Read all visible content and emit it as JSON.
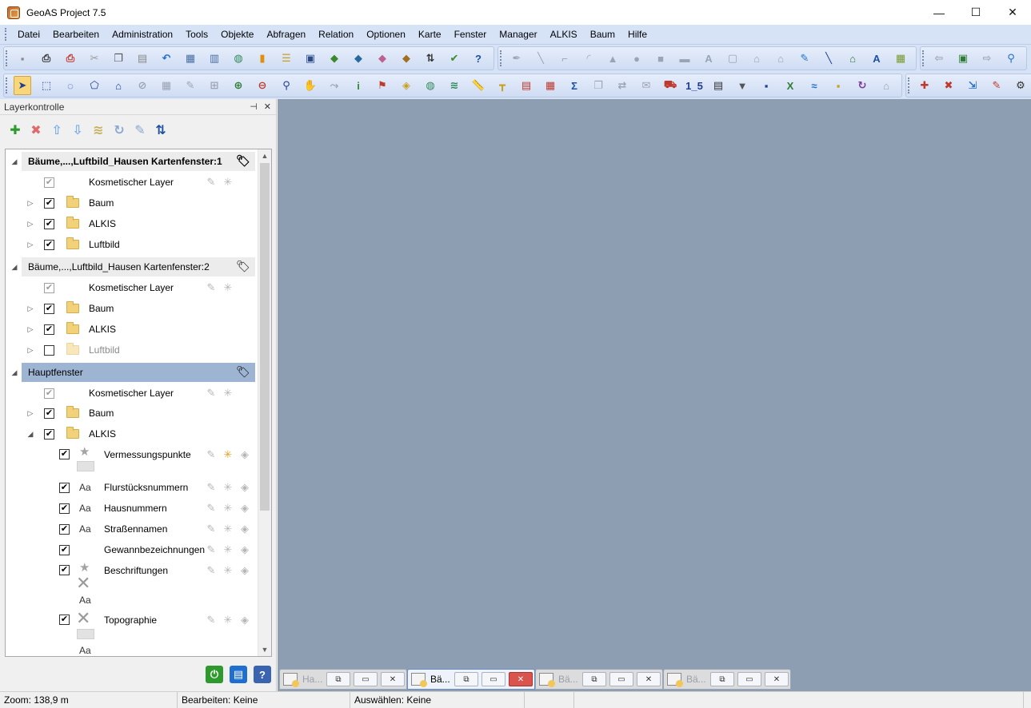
{
  "window": {
    "title": "GeoAS Project 7.5",
    "minimize": "—",
    "maximize": "☐",
    "close": "✕"
  },
  "menu": [
    "Datei",
    "Bearbeiten",
    "Administration",
    "Tools",
    "Objekte",
    "Abfragen",
    "Relation",
    "Optionen",
    "Karte",
    "Fenster",
    "Manager",
    "ALKIS",
    "Baum",
    "Hilfe"
  ],
  "toolbar1": {
    "group1": [
      {
        "name": "save-icon",
        "glyph": "▪",
        "color": "#8a8a8a"
      },
      {
        "name": "print-icon",
        "glyph": "⎙",
        "color": "#333333"
      },
      {
        "name": "pdf-print-icon",
        "glyph": "⎙",
        "color": "#c0392b"
      },
      {
        "name": "cut-icon",
        "glyph": "✂",
        "color": "#9a9a9a"
      },
      {
        "name": "copy-icon",
        "glyph": "❐",
        "color": "#555555"
      },
      {
        "name": "paste-icon",
        "glyph": "▤",
        "color": "#8a8a8a"
      },
      {
        "name": "undo-icon",
        "glyph": "↶",
        "color": "#1f6fd0"
      },
      {
        "name": "table-icon",
        "glyph": "▦",
        "color": "#4a6fa5"
      },
      {
        "name": "table-view-icon",
        "glyph": "▥",
        "color": "#4a6fa5"
      },
      {
        "name": "map-globe-icon",
        "glyph": "◍",
        "color": "#2e8b57"
      },
      {
        "name": "chart-icon",
        "glyph": "▮",
        "color": "#e08e0b"
      },
      {
        "name": "list-icon",
        "glyph": "☰",
        "color": "#c8a020"
      },
      {
        "name": "layer-window-icon",
        "glyph": "▣",
        "color": "#2a4a8a"
      },
      {
        "name": "map-green-icon",
        "glyph": "◆",
        "color": "#3a8a2a"
      },
      {
        "name": "map-tool-icon",
        "glyph": "◆",
        "color": "#2a6a9a"
      },
      {
        "name": "map-pink-icon",
        "glyph": "◆",
        "color": "#c06090"
      },
      {
        "name": "map-edit-icon",
        "glyph": "◆",
        "color": "#a07020"
      },
      {
        "name": "sort-az-icon",
        "glyph": "⇅",
        "color": "#333333"
      },
      {
        "name": "map-check-icon",
        "glyph": "✔",
        "color": "#3a8a2a"
      },
      {
        "name": "help-icon",
        "glyph": "?",
        "color": "#1f4fa0"
      }
    ],
    "group2": [
      {
        "name": "point-pin-icon",
        "glyph": "✒",
        "color": "#9aa4b2"
      },
      {
        "name": "line-icon",
        "glyph": "╲",
        "color": "#9aa4b2"
      },
      {
        "name": "polyline-icon",
        "glyph": "⌐",
        "color": "#9aa4b2"
      },
      {
        "name": "arc-icon",
        "glyph": "◜",
        "color": "#9aa4b2"
      },
      {
        "name": "polygon-icon",
        "glyph": "▲",
        "color": "#9aa4b2"
      },
      {
        "name": "ellipse-icon",
        "glyph": "●",
        "color": "#9aa4b2"
      },
      {
        "name": "rectangle-icon",
        "glyph": "■",
        "color": "#9aa4b2"
      },
      {
        "name": "rounded-rect-icon",
        "glyph": "▬",
        "color": "#9aa4b2"
      },
      {
        "name": "text-a-icon",
        "glyph": "A",
        "color": "#9aa4b2"
      },
      {
        "name": "frame-icon",
        "glyph": "▢",
        "color": "#9aa4b2"
      },
      {
        "name": "house-outline-icon",
        "glyph": "⌂",
        "color": "#9aa4b2"
      },
      {
        "name": "house-add-icon",
        "glyph": "⌂",
        "color": "#9aa4b2"
      },
      {
        "name": "pin-blue-icon",
        "glyph": "✎",
        "color": "#1f6fd0"
      },
      {
        "name": "line-blue-icon",
        "glyph": "╲",
        "color": "#1f3f90"
      },
      {
        "name": "house-green-icon",
        "glyph": "⌂",
        "color": "#2e7d32"
      },
      {
        "name": "text-blue-icon",
        "glyph": "A",
        "color": "#1f4fa0"
      },
      {
        "name": "grid-edit-icon",
        "glyph": "▦",
        "color": "#7a9a2a"
      }
    ],
    "group3": [
      {
        "name": "back-icon",
        "glyph": "⇦",
        "color": "#9aa4b2"
      },
      {
        "name": "zoom-window-icon",
        "glyph": "▣",
        "color": "#2e7d32"
      },
      {
        "name": "forward-icon",
        "glyph": "⇨",
        "color": "#9aa4b2"
      },
      {
        "name": "search-map-icon",
        "glyph": "⚲",
        "color": "#1f6fd0"
      }
    ]
  },
  "toolbar2": {
    "group1": [
      {
        "name": "select-arrow-icon",
        "glyph": "➤",
        "color": "#1f3f90",
        "active": true
      },
      {
        "name": "select-rect-icon",
        "glyph": "⬚",
        "color": "#1f3f90"
      },
      {
        "name": "select-circle-icon",
        "glyph": "◌",
        "color": "#1f3f90"
      },
      {
        "name": "select-polygon-icon",
        "glyph": "⬠",
        "color": "#1f3f90"
      },
      {
        "name": "select-house-icon",
        "glyph": "⌂",
        "color": "#1f3f90"
      },
      {
        "name": "deselect-icon",
        "glyph": "⊘",
        "color": "#9aa4b2"
      },
      {
        "name": "select-grid-icon",
        "glyph": "▦",
        "color": "#9aa4b2"
      },
      {
        "name": "pencil-icon",
        "glyph": "✎",
        "color": "#9aa4b2"
      },
      {
        "name": "ruler-select-icon",
        "glyph": "⊞",
        "color": "#9aa4b2"
      },
      {
        "name": "zoom-in-icon",
        "glyph": "⊕",
        "color": "#2e7d32"
      },
      {
        "name": "zoom-out-icon",
        "glyph": "⊖",
        "color": "#c0392b"
      },
      {
        "name": "zoom-search-icon",
        "glyph": "⚲",
        "color": "#1f3f90"
      },
      {
        "name": "pan-hand-icon",
        "glyph": "✋",
        "color": "#555555"
      },
      {
        "name": "route-icon",
        "glyph": "⤳",
        "color": "#9aa4b2"
      },
      {
        "name": "info-icon",
        "glyph": "i",
        "color": "#2e8b2e"
      },
      {
        "name": "flag-icon",
        "glyph": "⚑",
        "color": "#c0392b"
      },
      {
        "name": "tag-icon",
        "glyph": "◈",
        "color": "#c8a020"
      },
      {
        "name": "map-click-icon",
        "glyph": "◍",
        "color": "#2e8b57"
      },
      {
        "name": "layers-icon",
        "glyph": "≋",
        "color": "#2e8b57"
      },
      {
        "name": "measure-icon",
        "glyph": "📏",
        "color": "#c8a020"
      },
      {
        "name": "t-ruler-icon",
        "glyph": "┳",
        "color": "#c8a020"
      },
      {
        "name": "legend-icon",
        "glyph": "▤",
        "color": "#c0392b"
      },
      {
        "name": "table-delete-icon",
        "glyph": "▦",
        "color": "#c0392b"
      },
      {
        "name": "sum-icon",
        "glyph": "Σ",
        "color": "#1f4fa0"
      },
      {
        "name": "copy-object-icon",
        "glyph": "❐",
        "color": "#9aa4b2"
      },
      {
        "name": "move-object-icon",
        "glyph": "⇄",
        "color": "#9aa4b2"
      },
      {
        "name": "envelope-icon",
        "glyph": "✉",
        "color": "#9aa4b2"
      },
      {
        "name": "car-icon",
        "glyph": "⛟",
        "color": "#c0392b"
      },
      {
        "name": "scale-bar-icon",
        "glyph": "1_5",
        "color": "#1f3f90"
      },
      {
        "name": "report-icon",
        "glyph": "▤",
        "color": "#333333"
      },
      {
        "name": "filter-icon",
        "glyph": "▼",
        "color": "#555555"
      },
      {
        "name": "save-disk-icon",
        "glyph": "▪",
        "color": "#1f3f90"
      },
      {
        "name": "excel-icon",
        "glyph": "X",
        "color": "#2e7d32"
      },
      {
        "name": "wave-icon",
        "glyph": "≈",
        "color": "#1f6fd0"
      },
      {
        "name": "disk-yellow-icon",
        "glyph": "▪",
        "color": "#c8a020"
      },
      {
        "name": "refresh-icon",
        "glyph": "↻",
        "color": "#7a3a9a"
      },
      {
        "name": "house-plus-icon",
        "glyph": "⌂",
        "color": "#9aa4b2"
      }
    ],
    "group2": [
      {
        "name": "layer-add-icon",
        "glyph": "✚",
        "color": "#c0392b"
      },
      {
        "name": "layer-delete-icon",
        "glyph": "✖",
        "color": "#c0392b"
      },
      {
        "name": "layer-import-icon",
        "glyph": "⇲",
        "color": "#1f6fd0"
      },
      {
        "name": "layer-edit-icon",
        "glyph": "✎",
        "color": "#c0392b"
      },
      {
        "name": "layer-settings-icon",
        "glyph": "⚙",
        "color": "#333333"
      }
    ]
  },
  "panel": {
    "title": "Layerkontrolle",
    "pin": "⊣",
    "close": "✕",
    "tools": [
      {
        "name": "add-layer-icon",
        "glyph": "✚",
        "color": "#2e9a2e"
      },
      {
        "name": "remove-layer-icon",
        "glyph": "✖",
        "color": "#e06a6a"
      },
      {
        "name": "move-up-icon",
        "glyph": "⇧",
        "color": "#7aaee8"
      },
      {
        "name": "move-down-icon",
        "glyph": "⇩",
        "color": "#7aaee8"
      },
      {
        "name": "layer-group-icon",
        "glyph": "≋",
        "color": "#c8b060"
      },
      {
        "name": "layer-refresh-icon",
        "glyph": "↻",
        "color": "#8aa8d0"
      },
      {
        "name": "layer-props-icon",
        "glyph": "✎",
        "color": "#8aa8d0"
      },
      {
        "name": "layer-sort-icon",
        "glyph": "⇅",
        "color": "#1f4fa0"
      }
    ],
    "windows": [
      {
        "title": "Bäume,...,Luftbild_Hausen Kartenfenster:1"
      },
      {
        "title": "Bäume,...,Luftbild_Hausen Kartenfenster:2"
      },
      {
        "title": "Hauptfenster"
      }
    ],
    "cosmetic_layer": "Kosmetischer Layer",
    "folders": {
      "baum": "Baum",
      "alkis": "ALKIS",
      "luftbild": "Luftbild"
    },
    "alkis_layers": [
      "Vermessungspunkte",
      "Flurstücksnummern",
      "Hausnummern",
      "Straßennamen",
      "Gewannbezeichnungen",
      "Beschriftungen",
      "Topographie"
    ],
    "aa": "Aa",
    "bottom": [
      {
        "name": "apply-icon",
        "glyph": "⏻",
        "color": "#2e9a2e"
      },
      {
        "name": "layer-list-icon",
        "glyph": "▤",
        "color": "#1f6fd0"
      },
      {
        "name": "panel-help-icon",
        "glyph": "?",
        "color": "#3a63b0"
      }
    ]
  },
  "mdi_tabs": [
    {
      "title": "Ha...",
      "active": false
    },
    {
      "title": "Bä...",
      "active": true
    },
    {
      "title": "Bä...",
      "active": false
    },
    {
      "title": "Bä...",
      "active": false
    }
  ],
  "mdi_buttons": {
    "restore": "⧉",
    "maximize": "▭",
    "close": "✕"
  },
  "status": {
    "zoom": "Zoom: 138,9 m",
    "edit": "Bearbeiten: Keine",
    "select": "Auswählen: Keine"
  },
  "colors": {
    "accent": "#d6e3f7",
    "selection": "#9db4d2",
    "map_background": "#8d9db2"
  }
}
